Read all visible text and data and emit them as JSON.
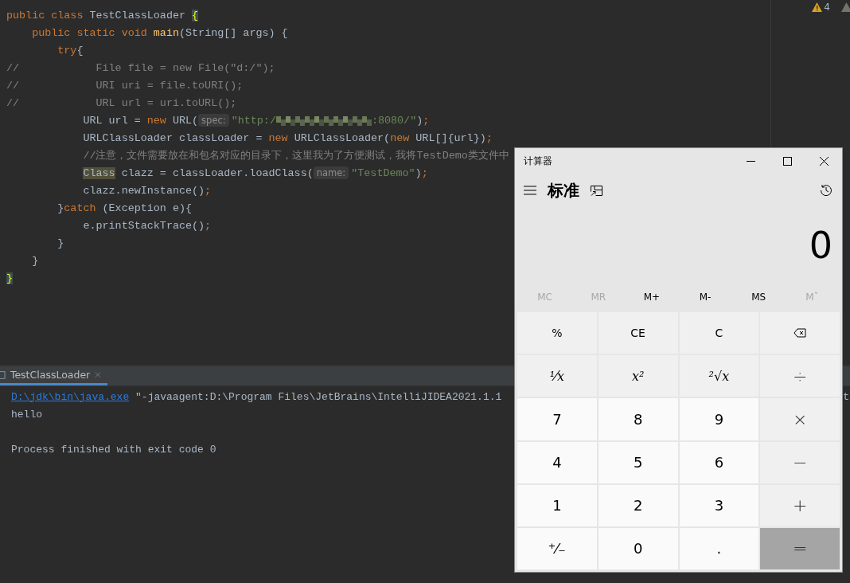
{
  "editor": {
    "inspections": {
      "count": "4"
    },
    "lines": [
      {
        "tokens": [
          {
            "kind": "kw",
            "text": "public class "
          },
          {
            "kind": "text",
            "text": "TestClassLoader "
          },
          {
            "kind": "match",
            "text": "{"
          }
        ]
      },
      {
        "tokens": [
          {
            "kind": "kw",
            "text": "    public static void "
          },
          {
            "kind": "method",
            "text": "main"
          },
          {
            "kind": "text",
            "text": "(String[] args) {"
          }
        ]
      },
      {
        "tokens": [
          {
            "kind": "kw",
            "text": "        try"
          },
          {
            "kind": "text",
            "text": "{"
          }
        ]
      },
      {
        "tokens": [
          {
            "kind": "comment",
            "text": "//            File file = new File(\"d:/\");"
          }
        ]
      },
      {
        "tokens": [
          {
            "kind": "comment",
            "text": "//            URI uri = file.toURI();"
          }
        ]
      },
      {
        "tokens": [
          {
            "kind": "comment",
            "text": "//            URL url = uri.toURL();"
          }
        ]
      },
      {
        "tokens": [
          {
            "kind": "text",
            "text": "            URL url = "
          },
          {
            "kind": "kw",
            "text": "new "
          },
          {
            "kind": "text",
            "text": "URL("
          },
          {
            "kind": "hint",
            "text": "spec:"
          },
          {
            "kind": "str",
            "text": "\"http:/"
          },
          {
            "kind": "mosaic"
          },
          {
            "kind": "str",
            "text": ":8080/\""
          },
          {
            "kind": "text",
            "text": ")"
          },
          {
            "kind": "punct",
            "text": ";"
          }
        ]
      },
      {
        "tokens": [
          {
            "kind": "text",
            "text": "            URLClassLoader classLoader = "
          },
          {
            "kind": "kw",
            "text": "new "
          },
          {
            "kind": "text",
            "text": "URLClassLoader("
          },
          {
            "kind": "kw",
            "text": "new "
          },
          {
            "kind": "text",
            "text": "URL[]{url})"
          },
          {
            "kind": "punct",
            "text": ";"
          }
        ]
      },
      {
        "tokens": [
          {
            "kind": "comment",
            "text": "            //注意，文件需要放在和包名对应的目录下，这里我为了方便测试，我将TestDemo类文件中"
          }
        ]
      },
      {
        "tokens": [
          {
            "kind": "usage",
            "text": "            Class"
          },
          {
            "kind": "text",
            "text": " clazz = classLoader.loadClass("
          },
          {
            "kind": "hint",
            "text": "name:"
          },
          {
            "kind": "str",
            "text": "\"TestDemo\""
          },
          {
            "kind": "text",
            "text": ")"
          },
          {
            "kind": "punct",
            "text": ";"
          }
        ]
      },
      {
        "tokens": [
          {
            "kind": "text",
            "text": "            clazz.newInstance()"
          },
          {
            "kind": "punct",
            "text": ";"
          }
        ]
      },
      {
        "tokens": [
          {
            "kind": "text",
            "text": "        }"
          },
          {
            "kind": "kw",
            "text": "catch "
          },
          {
            "kind": "text",
            "text": "(Exception e){"
          }
        ]
      },
      {
        "tokens": [
          {
            "kind": "text",
            "text": "            e.printStackTrace()"
          },
          {
            "kind": "punct",
            "text": ";"
          }
        ]
      },
      {
        "tokens": [
          {
            "kind": "text",
            "text": "        }"
          }
        ]
      },
      {
        "tokens": [
          {
            "kind": "text",
            "text": "    }"
          }
        ]
      },
      {
        "tokens": [
          {
            "kind": "match",
            "text": "}"
          }
        ]
      }
    ]
  },
  "run_panel": {
    "tabs": [
      {
        "label": "TestClassLoader",
        "selected": true
      }
    ],
    "lines": [
      {
        "tokens": [
          {
            "kind": "link",
            "text": "D:\\jdk\\bin\\java.exe"
          },
          {
            "kind": "text",
            "text": " \"-javaagent:D:\\Program Files\\JetBrains\\IntelliJIDEA2021.1.1"
          }
        ],
        "tail": "t"
      },
      {
        "tokens": [
          {
            "kind": "text",
            "text": "hello"
          }
        ]
      },
      {
        "kind": "summary",
        "tokens": [
          {
            "kind": "text",
            "text": "Process finished with exit code 0"
          }
        ]
      }
    ]
  },
  "calculator": {
    "title": "计算器",
    "mode": "标准",
    "display": "0",
    "memory": [
      {
        "label": "MC",
        "disabled": true
      },
      {
        "label": "MR",
        "disabled": true
      },
      {
        "label": "M+",
        "disabled": false
      },
      {
        "label": "M-",
        "disabled": false
      },
      {
        "label": "MS",
        "disabled": false
      },
      {
        "label": "Mˇ",
        "disabled": true
      }
    ],
    "keys": [
      {
        "kind": "function",
        "label": "%"
      },
      {
        "kind": "function",
        "label": "CE"
      },
      {
        "kind": "function",
        "label": "C"
      },
      {
        "kind": "backspace"
      },
      {
        "kind": "math",
        "label": "¹⁄x"
      },
      {
        "kind": "math",
        "label": "x²"
      },
      {
        "kind": "math",
        "label": "²√x"
      },
      {
        "kind": "operator",
        "label": "÷"
      },
      {
        "kind": "digit",
        "label": "7"
      },
      {
        "kind": "digit",
        "label": "8"
      },
      {
        "kind": "digit",
        "label": "9"
      },
      {
        "kind": "operator",
        "label": "×"
      },
      {
        "kind": "digit",
        "label": "4"
      },
      {
        "kind": "digit",
        "label": "5"
      },
      {
        "kind": "digit",
        "label": "6"
      },
      {
        "kind": "operator",
        "label": "−"
      },
      {
        "kind": "digit",
        "label": "1"
      },
      {
        "kind": "digit",
        "label": "2"
      },
      {
        "kind": "digit",
        "label": "3"
      },
      {
        "kind": "operator",
        "label": "+"
      },
      {
        "kind": "digit",
        "label": "⁺⁄₋"
      },
      {
        "kind": "digit",
        "label": "0"
      },
      {
        "kind": "digit",
        "label": "."
      },
      {
        "kind": "equals",
        "label": "="
      }
    ]
  }
}
